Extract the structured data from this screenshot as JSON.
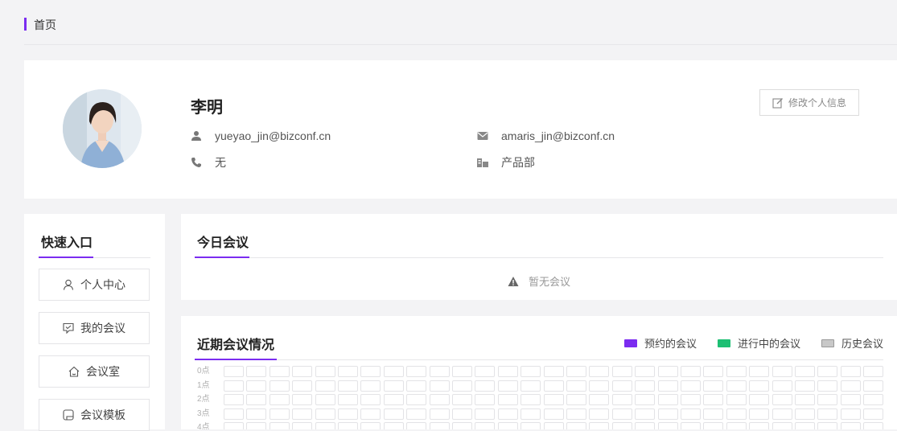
{
  "breadcrumb": {
    "label": "首页"
  },
  "profile": {
    "name": "李明",
    "login": "yueyao_jin@bizconf.cn",
    "email": "amaris_jin@bizconf.cn",
    "phone": "无",
    "department": "产品部",
    "edit_label": "修改个人信息"
  },
  "quick_entry": {
    "title": "快速入口",
    "items": [
      {
        "label": "个人中心",
        "icon": "user-icon"
      },
      {
        "label": "我的会议",
        "icon": "chat-icon"
      },
      {
        "label": "会议室",
        "icon": "home-icon"
      },
      {
        "label": "会议模板",
        "icon": "template-icon"
      }
    ]
  },
  "today": {
    "title": "今日会议",
    "empty_text": "暂无会议",
    "empty_icon": "warning-icon"
  },
  "recent": {
    "title": "近期会议情况",
    "legend": [
      {
        "label": "预约的会议",
        "color": "#7b2cf0"
      },
      {
        "label": "进行中的会议",
        "color": "#1dbf73"
      },
      {
        "label": "历史会议",
        "color": "#c8c8c8"
      }
    ],
    "hours": [
      "0点",
      "1点",
      "2点",
      "3点",
      "4点"
    ],
    "columns": 29
  },
  "colors": {
    "accent": "#7b2cf0"
  }
}
